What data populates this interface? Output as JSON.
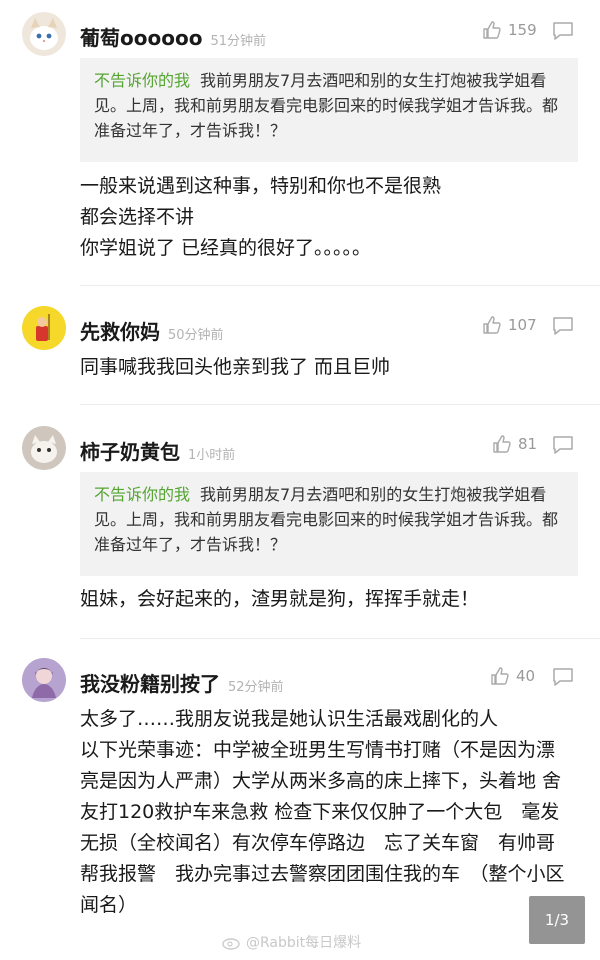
{
  "comments": [
    {
      "name": "葡萄oooooo",
      "time": "51分钟前",
      "likes": "159",
      "avatar": "cat-avatar",
      "quote": {
        "name": "不告诉你的我",
        "text": "我前男朋友7月去酒吧和别的女生打炮被我学姐看见。上周，我和前男朋友看完电影回来的时候我学姐才告诉我。都准备过年了，才告诉我！？"
      },
      "text": "一般来说遇到这种事，特别和你也不是很熟\n都会选择不讲\n你学姐说了 已经真的很好了。。。。。"
    },
    {
      "name": "先救你妈",
      "time": "50分钟前",
      "likes": "107",
      "avatar": "cartoon-avatar",
      "text": "同事喊我我回头他亲到我了 而且巨帅"
    },
    {
      "name": "柿子奶黄包",
      "time": "1小时前",
      "likes": "81",
      "avatar": "kitten-avatar",
      "quote": {
        "name": "不告诉你的我",
        "text": "我前男朋友7月去酒吧和别的女生打炮被我学姐看见。上周，我和前男朋友看完电影回来的时候我学姐才告诉我。都准备过年了，才告诉我！？"
      },
      "text": "姐妹，会好起来的，渣男就是狗，挥挥手就走！"
    },
    {
      "name": "我没粉籍别按了",
      "time": "52分钟前",
      "likes": "40",
      "avatar": "girl-avatar",
      "text": "太多了……我朋友说我是她认识生活最戏剧化的人\n以下光荣事迹：中学被全班男生写情书打赌（不是因为漂亮是因为人严肃）大学从两米多高的床上摔下，头着地 舍友打120救护车来急救 检查下来仅仅肿了一个大包　毫发无损（全校闻名）有次停车停路边　忘了关车窗　有帅哥帮我报警　我办完事过去警察团团围住我的车　（整个小区闻名）"
    }
  ],
  "pager": "1/3",
  "watermark": "@Rabbit每日爆料",
  "colors": {
    "quote_name": "#55a532",
    "time": "#b3b3b3",
    "quote_bg": "#f2f2f2"
  }
}
